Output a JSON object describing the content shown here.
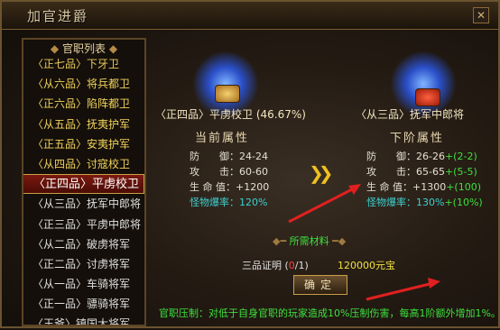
{
  "window": {
    "title": "加官进爵",
    "close_icon": "close-icon"
  },
  "list": {
    "header": "官职列表",
    "items": [
      {
        "label": "〈正七品〉下牙卫",
        "state": "partial"
      },
      {
        "label": "〈从六品〉将兵都卫",
        "state": "normal"
      },
      {
        "label": "〈正六品〉陷阵都卫",
        "state": "normal"
      },
      {
        "label": "〈从五品〉抚夷护军",
        "state": "normal"
      },
      {
        "label": "〈正五品〉安夷护军",
        "state": "normal"
      },
      {
        "label": "〈从四品〉讨寇校卫",
        "state": "normal"
      },
      {
        "label": "〈正四品〉平虏校卫",
        "state": "selected"
      },
      {
        "label": "〈从三品〉抚军中郎将",
        "state": "white"
      },
      {
        "label": "〈正三品〉平虏中郎将",
        "state": "white"
      },
      {
        "label": "〈从二品〉破虏将军",
        "state": "white"
      },
      {
        "label": "〈正二品〉讨虏将军",
        "state": "white"
      },
      {
        "label": "〈从一品〉车骑将军",
        "state": "white"
      },
      {
        "label": "〈正一品〉骠骑将军",
        "state": "white"
      },
      {
        "label": "〈王爷〉镇国大将军",
        "state": "white"
      }
    ]
  },
  "current": {
    "rank": "〈正四品〉平虏校卫",
    "progress": "(46.67%)",
    "section_title": "当前属性",
    "stats": {
      "defense_label": "防　　御：",
      "defense": "24-24",
      "attack_label": "攻　　击：",
      "attack": "60-60",
      "hp_label": "生 命 值：",
      "hp": "+1200",
      "crit_label": "怪物爆率：",
      "crit": "120%"
    }
  },
  "next": {
    "rank": "〈从三品〉抚军中郎将",
    "section_title": "下阶属性",
    "stats": {
      "defense_label": "防　　御：",
      "defense": "26-26",
      "defense_up": "+(2-2)",
      "attack_label": "攻　　击：",
      "attack": "65-65",
      "attack_up": "+(5-5)",
      "hp_label": "生 命 值：",
      "hp": "+1300",
      "hp_up": "+(100)",
      "crit_label": "怪物爆率：",
      "crit": "130%",
      "crit_up": "+(10%)"
    }
  },
  "materials": {
    "title": "所需材料",
    "item_name": "三品证明",
    "item_count_have": "0",
    "item_count_need": "1",
    "cost": "120000元宝"
  },
  "confirm_label": "确定",
  "footer": "官职压制：对低于自身官职的玩家造成10%压制伤害，每高1阶额外增加1%。",
  "colors": {
    "accent_gold": "#c9a048",
    "green": "#3ee03e",
    "yellow": "#f0d25a"
  }
}
